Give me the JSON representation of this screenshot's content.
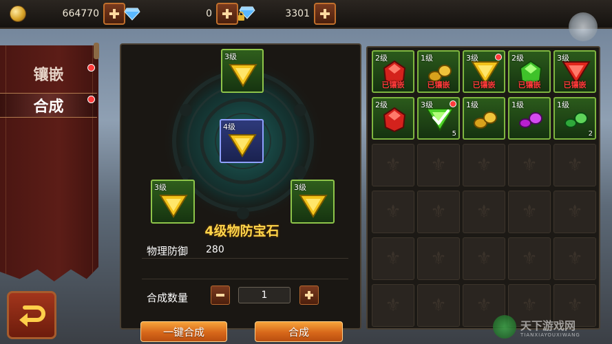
{
  "resources": [
    {
      "name": "gold",
      "value": "664770"
    },
    {
      "name": "diamond",
      "value": "0"
    },
    {
      "name": "bound-diamond",
      "value": "3301"
    }
  ],
  "tabs": [
    {
      "label": "镶嵌",
      "active": false,
      "badge": true
    },
    {
      "label": "合成",
      "active": true,
      "badge": true
    }
  ],
  "synthesis": {
    "result": {
      "level": "4级",
      "gem": "yellow-triangle"
    },
    "materials": [
      {
        "level": "3级",
        "gem": "yellow-triangle"
      },
      {
        "level": "3级",
        "gem": "yellow-triangle"
      },
      {
        "level": "3级",
        "gem": "yellow-triangle"
      }
    ],
    "gem_name": "4级物防宝石",
    "stat_label": "物理防御",
    "stat_value": "280",
    "quantity_label": "合成数量",
    "quantity_value": "1",
    "one_click_label": "一键合成",
    "combine_label": "合成"
  },
  "inventory": [
    {
      "level": "2级",
      "gem": "red-stone",
      "inlaid": "已镶嵌",
      "count": "",
      "badge": false
    },
    {
      "level": "1级",
      "gem": "yellow-stones",
      "inlaid": "已镶嵌",
      "count": "",
      "badge": false
    },
    {
      "level": "3级",
      "gem": "yellow-triangle",
      "inlaid": "已镶嵌",
      "count": "",
      "badge": true
    },
    {
      "level": "2级",
      "gem": "green-stone",
      "inlaid": "已镶嵌",
      "count": "",
      "badge": false
    },
    {
      "level": "3级",
      "gem": "red-triangle",
      "inlaid": "已镶嵌",
      "count": "",
      "badge": false
    },
    {
      "level": "2级",
      "gem": "red-stone",
      "inlaid": "",
      "count": "",
      "badge": false
    },
    {
      "level": "3级",
      "gem": "green-triangle-check",
      "inlaid": "",
      "count": "5",
      "badge": true
    },
    {
      "level": "1级",
      "gem": "yellow-stones",
      "inlaid": "",
      "count": "",
      "badge": false
    },
    {
      "level": "1级",
      "gem": "purple-stones",
      "inlaid": "",
      "count": "",
      "badge": false
    },
    {
      "level": "1级",
      "gem": "green-stones",
      "inlaid": "",
      "count": "2",
      "badge": false
    }
  ],
  "watermark": {
    "main": "天下游戏网",
    "sub": "TIANXIAYOUXIWANG"
  },
  "colors": {
    "accent": "#e0781e",
    "active_border": "#8fc64a",
    "inlaid_text": "#ff3a3a",
    "gem_name": "#ffd54a"
  }
}
